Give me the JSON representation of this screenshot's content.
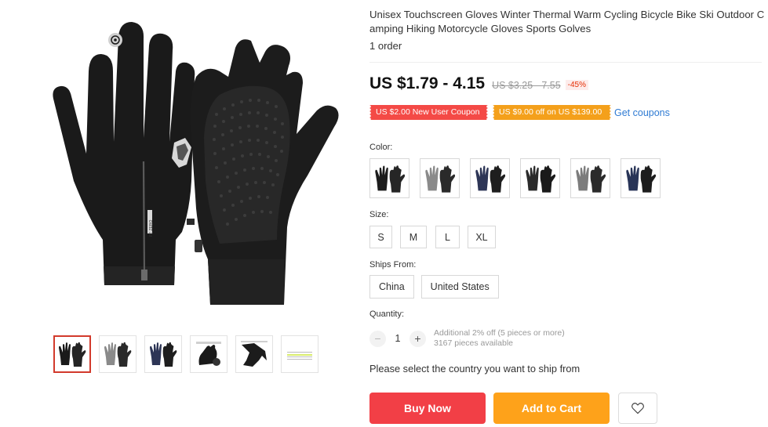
{
  "product": {
    "title": "Unisex Touchscreen Gloves Winter Thermal Warm Cycling Bicycle Bike Ski Outdoor Camping Hiking Motorcycle Gloves Sports Golves",
    "orders": "1 order"
  },
  "gallery": {
    "main_image_icon": "black-touchscreen-gloves-image",
    "glove_brand_text": "FF ZERO",
    "thumbnails": [
      {
        "icon": "black-gloves-thumbnail",
        "active": true
      },
      {
        "icon": "gray-gloves-thumbnail",
        "active": false
      },
      {
        "icon": "navy-gloves-thumbnail",
        "active": false
      },
      {
        "icon": "glove-detail-thumbnail",
        "active": false
      },
      {
        "icon": "glove-touchscreen-thumbnail",
        "active": false
      },
      {
        "icon": "size-chart-thumbnail",
        "active": false
      }
    ]
  },
  "pricing": {
    "price": "US $1.79 - 4.15",
    "original_price": "US $3.25 - 7.55",
    "discount": "-45%",
    "coupon_new_user": "US $2.00 New User Coupon",
    "coupon_off": "US $9.00 off on US $139.00",
    "get_coupons": "Get coupons",
    "colors": {
      "coupon_red": "#f44a46",
      "coupon_orange": "#f4a01b",
      "link": "#2f7bd3"
    }
  },
  "variants": {
    "color_label": "Color:",
    "color_options": [
      {
        "icon": "black-gloves-swatch",
        "glove_color": "#1c1c1c"
      },
      {
        "icon": "gray-gloves-swatch",
        "glove_color": "#8a8a8a"
      },
      {
        "icon": "navy-gloves-swatch",
        "glove_color": "#2d3556"
      },
      {
        "icon": "black-gloves-swatch",
        "glove_color": "#2a2a2a"
      },
      {
        "icon": "gray-gloves-swatch",
        "glove_color": "#7c7c7c"
      },
      {
        "icon": "navy-gloves-swatch",
        "glove_color": "#283457"
      }
    ],
    "size_label": "Size:",
    "sizes": [
      "S",
      "M",
      "L",
      "XL"
    ],
    "ships_from_label": "Ships From:",
    "ships_from": [
      "China",
      "United States"
    ]
  },
  "quantity": {
    "label": "Quantity:",
    "decrement": "−",
    "value": "1",
    "increment": "+",
    "discount_note": "Additional 2% off (5 pieces or more)",
    "available": "3167 pieces available"
  },
  "shipping": {
    "message": "Please select the country you want to ship from"
  },
  "actions": {
    "buy_now": "Buy Now",
    "add_to_cart": "Add to Cart",
    "wishlist_icon": "heart-icon",
    "colors": {
      "buy": "#f23f46",
      "cart": "#fea21a"
    }
  }
}
